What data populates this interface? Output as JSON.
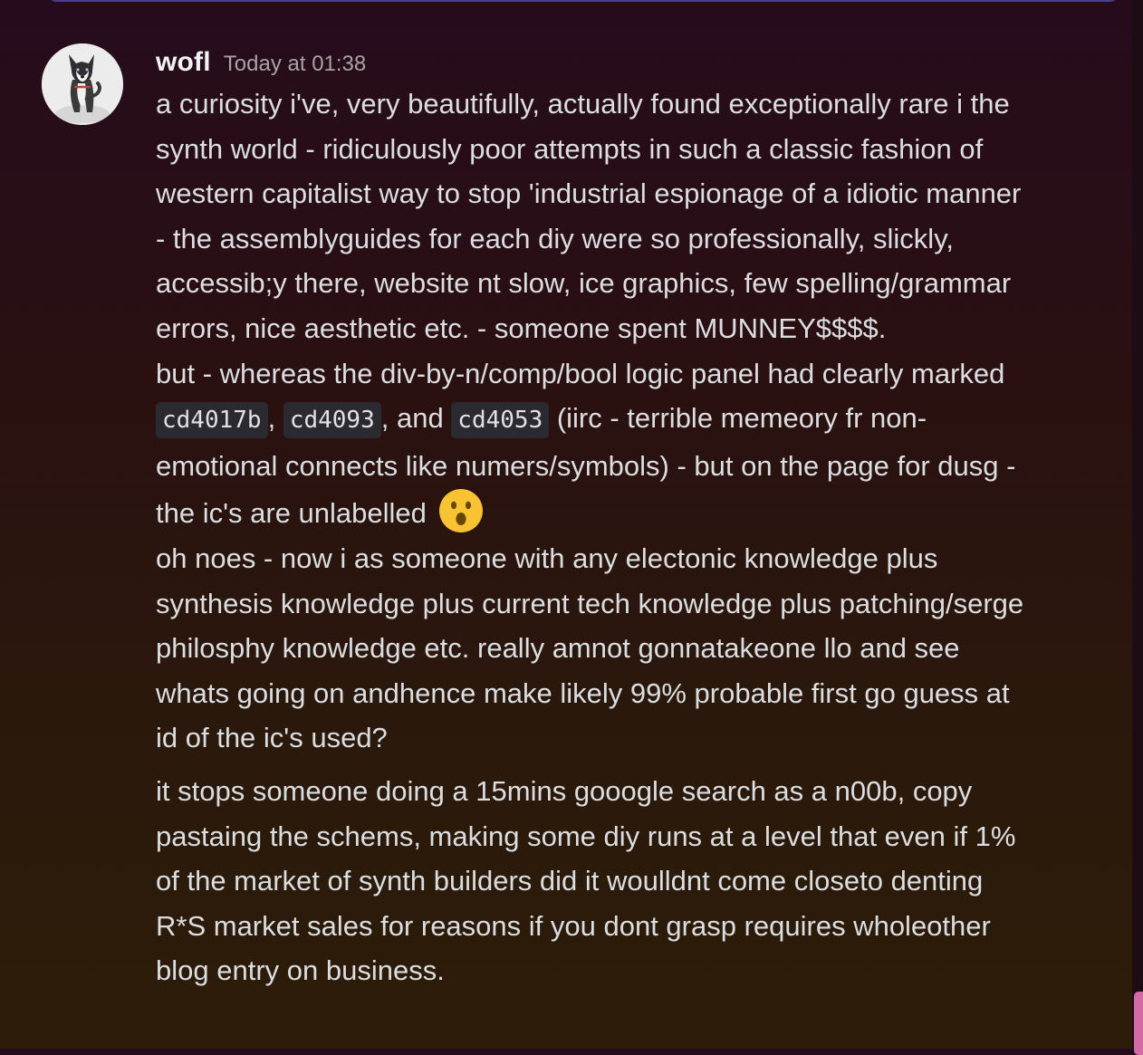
{
  "message": {
    "author": "wofl",
    "timestamp": "Today at 01:38",
    "paragraph1": "a curiosity i've, very beautifully, actually found exceptionally rare i the synth world - ridiculously poor attempts in such a classic fashion of western capitalist way to stop 'industrial espionage of a idiotic manner - the assemblyguides for each diy were so professionally, slickly, accessib;y there, website nt slow, ice graphics, few spelling/grammar errors, nice aesthetic etc. - someone spent MUNNEY$$$$.",
    "paragraph2": {
      "before_code": "but - whereas the div-by-n/comp/bool logic panel had clearly marked ",
      "code1": "cd4017b",
      "sep1": ", ",
      "code2": "cd4093",
      "sep2": ", and ",
      "code3": "cd4053",
      "after_code": " (iirc - terrible memeory fr non-emotional connects like numers/symbols) - but on the page for dusg - the ic's are unlabelled ",
      "emoji": "hushed-face-emoji"
    },
    "paragraph3": "oh noes - now i as someone with any electonic knowledge plus synthesis knowledge plus current tech knowledge plus patching/serge philosphy knowledge etc. really amnot gonnatakeone llo and see whats going on andhence make likely 99% probable first go guess at id of the ic's used?",
    "paragraph4": "it stops someone doing a 15mins gooogle search as a n00b, copy pastaing the schems, making some diy runs at a level that even if 1% of the market of synth builders did it woulldnt come closeto denting R*S market sales for reasons if you dont grasp requires wholeother blog entry on business.",
    "avatar_icon": "husky-dog-avatar"
  },
  "colors": {
    "username": "#f2f3f5",
    "timestamp": "#a8a3a6",
    "body_text": "#dbdee1",
    "code_bg": "#2a2a30",
    "scroll_thumb": "#d36aa6"
  }
}
